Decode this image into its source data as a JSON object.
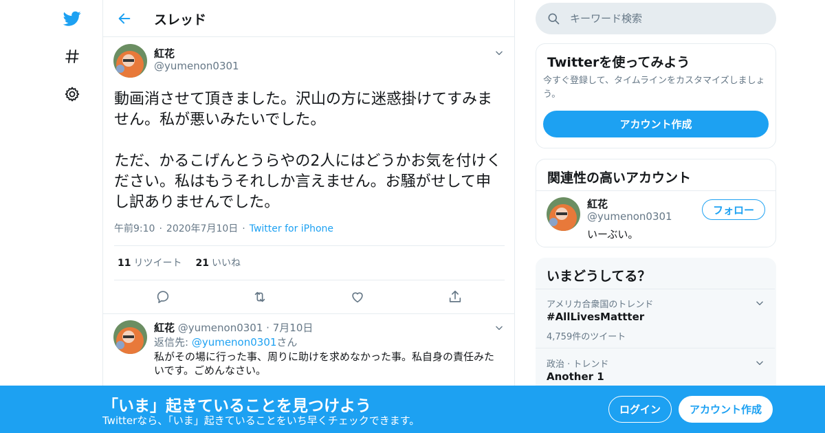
{
  "colors": {
    "accent": "#1da1f2",
    "text": "#14171a",
    "secondary": "#657786",
    "border": "#e6ecf0",
    "banner": "#1da1f2"
  },
  "nav": {
    "icons": [
      "twitter-bird-icon",
      "hashtag-icon",
      "gear-icon"
    ]
  },
  "header": {
    "title": "スレッド"
  },
  "main_tweet": {
    "name": "紅花",
    "handle": "@yumenon0301",
    "paragraphs": [
      "動画消させて頂きました。沢山の方に迷惑掛けてすみません。私が悪いみたいでした。",
      "ただ、かるこげんとうらやの2人にはどうかお気を付けください。私はもうそれしか言えません。お騒がせして申し訳ありませんでした。"
    ],
    "time": "午前9:10",
    "date": "2020年7月10日",
    "source": "Twitter for iPhone",
    "retweets": "11",
    "retweets_label": "リツイート",
    "likes": "21",
    "likes_label": "いいね"
  },
  "reply": {
    "name": "紅花",
    "handle": "@yumenon0301",
    "date": "7月10日",
    "reply_prefix": "返信先: ",
    "reply_to": "@yumenon0301",
    "reply_suffix": "さん",
    "text": "私がその場に行った事、周りに助けを求めなかった事。私自身の責任みたいです。ごめんなさい。"
  },
  "search": {
    "placeholder": "キーワード検索"
  },
  "signup_card": {
    "title": "Twitterを使ってみよう",
    "subtitle": "今すぐ登録して、タイムラインをカスタマイズしましょう。",
    "button": "アカウント作成"
  },
  "related_card": {
    "title": "関連性の高いアカウント",
    "name": "紅花",
    "handle": "@yumenon0301",
    "bio": "いーぶい。",
    "follow": "フォロー"
  },
  "trends_card": {
    "title": "いまどうしてる？",
    "items": [
      {
        "context": "アメリカ合衆国のトレンド",
        "name": "#AllLivesMattter",
        "count": "4,759件のツイート"
      },
      {
        "context": "政治 · トレンド",
        "name": "Another 1",
        "count": ""
      }
    ]
  },
  "banner": {
    "title": "「いま」起きていることを見つけよう",
    "subtitle": "Twitterなら、「いま」起きていることをいち早くチェックできます。",
    "login": "ログイン",
    "signup": "アカウント作成"
  }
}
